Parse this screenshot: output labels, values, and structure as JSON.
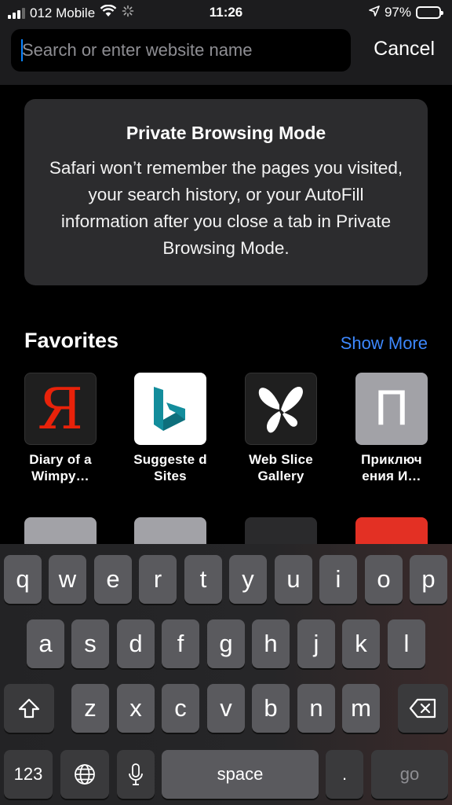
{
  "status_bar": {
    "carrier": "012 Mobile",
    "time": "11:26",
    "battery": "97%",
    "battery_level": 0.97,
    "icons": [
      "signal-icon",
      "wifi-icon",
      "activity-spinner-icon",
      "location-arrow-icon",
      "battery-icon"
    ]
  },
  "search": {
    "placeholder": "Search or enter website name",
    "value": "",
    "cancel_label": "Cancel"
  },
  "private_card": {
    "title": "Private Browsing Mode",
    "text": "Safari won’t remember the pages you visited, your search history, or your AutoFill information after you close a tab in Private Browsing Mode."
  },
  "favorites": {
    "title": "Favorites",
    "show_more": "Show More",
    "items": [
      {
        "label": "Diary of a Wimpy…",
        "glyph": "Я",
        "icon": "yandex-icon"
      },
      {
        "label": "Suggeste d Sites",
        "icon": "bing-icon"
      },
      {
        "label": "Web Slice Gallery",
        "icon": "butterfly-icon"
      },
      {
        "label": "Приключ ения И…",
        "glyph": "П",
        "icon": "letter-p-icon"
      }
    ]
  },
  "keyboard": {
    "row1": [
      "q",
      "w",
      "e",
      "r",
      "t",
      "y",
      "u",
      "i",
      "o",
      "p"
    ],
    "row2": [
      "a",
      "s",
      "d",
      "f",
      "g",
      "h",
      "j",
      "k",
      "l"
    ],
    "row3": [
      "z",
      "x",
      "c",
      "v",
      "b",
      "n",
      "m"
    ],
    "numbers_label": "123",
    "space_label": "space",
    "period_label": ".",
    "go_label": "go"
  },
  "colors": {
    "accent": "#0a84ff",
    "link": "#3d88ff",
    "card": "#2c2c2e",
    "key": "#5a5a5e",
    "key_dark": "#3a3a3c"
  }
}
